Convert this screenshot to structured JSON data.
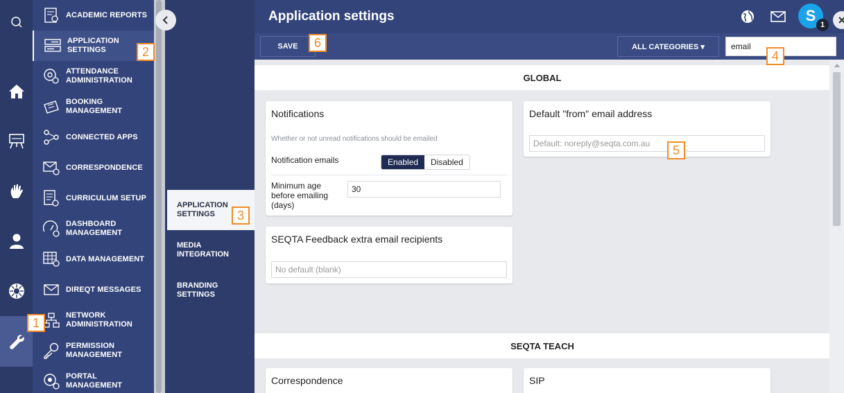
{
  "header": {
    "title": "Application settings",
    "avatar_letter": "S",
    "badge_count": "1"
  },
  "toolbar": {
    "save_label": "SAVE",
    "categories_label": "ALL CATEGORIES ▾",
    "search_value": "email"
  },
  "menu": {
    "items": [
      {
        "label": "ACADEMIC REPORTS"
      },
      {
        "label": "APPLICATION SETTINGS"
      },
      {
        "label": "ATTENDANCE ADMINISTRATION"
      },
      {
        "label": "BOOKING MANAGEMENT"
      },
      {
        "label": "CONNECTED APPS"
      },
      {
        "label": "CORRESPONDENCE"
      },
      {
        "label": "CURRICULUM SETUP"
      },
      {
        "label": "DASHBOARD MANAGEMENT"
      },
      {
        "label": "DATA MANAGEMENT"
      },
      {
        "label": "DIREQT MESSAGES"
      },
      {
        "label": "NETWORK ADMINISTRATION"
      },
      {
        "label": "PERMISSION MANAGEMENT"
      },
      {
        "label": "PORTAL MANAGEMENT"
      }
    ]
  },
  "subnav": {
    "items": [
      {
        "label": "APPLICATION SETTINGS"
      },
      {
        "label": "MEDIA INTEGRATION"
      },
      {
        "label": "BRANDING SETTINGS"
      }
    ]
  },
  "sections": {
    "global": "GLOBAL",
    "teach": "SEQTA TEACH"
  },
  "cards": {
    "notifications": {
      "title": "Notifications",
      "desc": "Whether or not unread notifications should be emailed",
      "emails_label": "Notification emails",
      "enabled": "Enabled",
      "disabled": "Disabled",
      "min_age_label": "Minimum age before emailing (days)",
      "min_age_value": "30"
    },
    "from_email": {
      "title": "Default \"from\" email address",
      "placeholder": "Default: noreply@seqta.com.au"
    },
    "feedback": {
      "title": "SEQTA Feedback extra email recipients",
      "placeholder": "No default (blank)"
    },
    "correspondence": {
      "title": "Correspondence"
    },
    "sip": {
      "title": "SIP"
    }
  },
  "annotations": [
    "1",
    "2",
    "3",
    "4",
    "5",
    "6"
  ],
  "colors": {
    "rail": "#2b3a67",
    "menu": "#33447a",
    "accent_annotation": "#f28b26",
    "avatar": "#1aa3e8"
  }
}
